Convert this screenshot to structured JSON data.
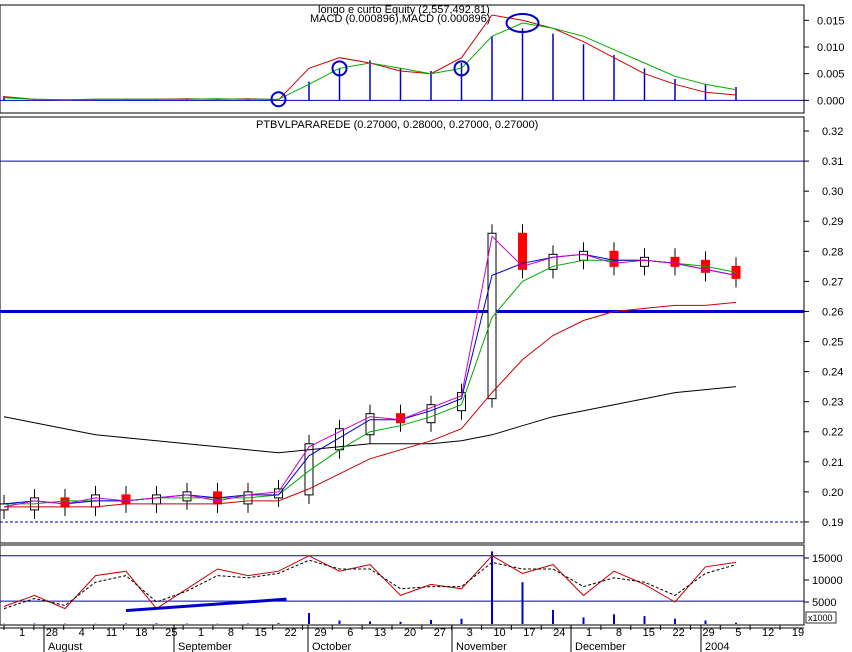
{
  "macd_panel": {
    "title_line1": "longo e curto Equity (2,557,492.81)",
    "title_line2": "MACD (0.000896),MACD (0.000896)",
    "y_ticks": [
      "0.015",
      "0.010",
      "0.005",
      "0.000"
    ],
    "ylim": [
      -0.002,
      0.0175
    ]
  },
  "price_panel": {
    "title": "PTBVLPARAREDE (0.27000, 0.28000, 0.27000, 0.27000)",
    "y_ticks": [
      "0.32",
      "0.31",
      "0.30",
      "0.29",
      "0.28",
      "0.27",
      "0.26",
      "0.25",
      "0.24",
      "0.23",
      "0.22",
      "0.21",
      "0.20",
      "0.19"
    ],
    "ylim": [
      0.184,
      0.324
    ],
    "levels": {
      "resistance": 0.31,
      "support": 0.26,
      "dotted": 0.19
    }
  },
  "volume_panel": {
    "y_ticks": [
      "15000",
      "10000",
      "5000"
    ],
    "unit": "x1000",
    "ylim": [
      0,
      17500
    ],
    "levels": [
      15500,
      5200
    ]
  },
  "x_axis": {
    "day_ticks": [
      "1",
      "28",
      "4",
      "11",
      "18",
      "25",
      "1",
      "8",
      "15",
      "22",
      "29",
      "6",
      "13",
      "20",
      "27",
      "3",
      "10",
      "17",
      "24",
      "1",
      "8",
      "15",
      "22",
      "29",
      "5",
      "12",
      "19"
    ],
    "months": [
      "August",
      "September",
      "October",
      "November",
      "December",
      "2004"
    ]
  },
  "chart_data": {
    "type": "stock-candlestick-with-indicators",
    "instrument": "PTBVLPARAREDE",
    "last": {
      "open": 0.27,
      "high": 0.28,
      "low": 0.27,
      "close": 0.27
    },
    "weeks": [
      "Jul 28",
      "Aug 4",
      "Aug 11",
      "Aug 18",
      "Aug 25",
      "Sep 1",
      "Sep 8",
      "Sep 15",
      "Sep 22",
      "Sep 29",
      "Oct 6",
      "Oct 13",
      "Oct 20",
      "Oct 27",
      "Nov 3",
      "Nov 10",
      "Nov 17",
      "Nov 24",
      "Dec 1",
      "Dec 8",
      "Dec 15",
      "Dec 22",
      "Dec 29",
      "Jan 5",
      "Jan 12"
    ],
    "price_close": [
      0.195,
      0.197,
      0.196,
      0.198,
      0.197,
      0.198,
      0.199,
      0.197,
      0.199,
      0.2,
      0.215,
      0.22,
      0.225,
      0.224,
      0.228,
      0.232,
      0.285,
      0.275,
      0.278,
      0.279,
      0.276,
      0.277,
      0.276,
      0.274,
      0.272
    ],
    "ma_short": [
      0.196,
      0.197,
      0.196,
      0.197,
      0.197,
      0.198,
      0.199,
      0.198,
      0.199,
      0.199,
      0.212,
      0.218,
      0.224,
      0.224,
      0.227,
      0.231,
      0.272,
      0.276,
      0.278,
      0.279,
      0.277,
      0.277,
      0.276,
      0.274,
      0.272
    ],
    "ma_mid": [
      0.196,
      0.196,
      0.197,
      0.197,
      0.197,
      0.198,
      0.198,
      0.198,
      0.198,
      0.199,
      0.207,
      0.214,
      0.22,
      0.222,
      0.225,
      0.229,
      0.258,
      0.27,
      0.275,
      0.277,
      0.277,
      0.277,
      0.276,
      0.275,
      0.273
    ],
    "ma_long": [
      0.195,
      0.195,
      0.195,
      0.195,
      0.196,
      0.196,
      0.196,
      0.196,
      0.197,
      0.197,
      0.201,
      0.206,
      0.211,
      0.214,
      0.217,
      0.221,
      0.233,
      0.244,
      0.252,
      0.257,
      0.26,
      0.261,
      0.262,
      0.262,
      0.263
    ],
    "ma_longest": [
      0.225,
      0.223,
      0.221,
      0.219,
      0.218,
      0.217,
      0.216,
      0.215,
      0.214,
      0.213,
      0.214,
      0.215,
      0.216,
      0.216,
      0.216,
      0.217,
      0.219,
      0.222,
      0.225,
      0.227,
      0.229,
      0.231,
      0.233,
      0.234,
      0.235
    ],
    "macd_line": [
      0.0007,
      0.0002,
      0.0001,
      0.0002,
      0.0002,
      0.0002,
      0.0003,
      0.0002,
      0.0003,
      0.0001,
      0.006,
      0.008,
      0.007,
      0.0055,
      0.005,
      0.008,
      0.016,
      0.015,
      0.0135,
      0.011,
      0.008,
      0.005,
      0.003,
      0.0015,
      0.001
    ],
    "macd_signal": [
      0.0005,
      0.0002,
      0.0001,
      0.0002,
      0.0002,
      0.0002,
      0.0002,
      0.0003,
      0.0002,
      0.0002,
      0.003,
      0.006,
      0.007,
      0.006,
      0.005,
      0.006,
      0.012,
      0.0145,
      0.0135,
      0.012,
      0.0095,
      0.007,
      0.0045,
      0.003,
      0.002
    ],
    "macd_hist": [
      0.0008,
      0.0003,
      0.0002,
      0.0002,
      0.0003,
      0.0003,
      0.0002,
      0.0003,
      0.0002,
      0.0002,
      0.0035,
      0.006,
      0.0075,
      0.006,
      0.0055,
      0.007,
      0.012,
      0.0135,
      0.0125,
      0.0105,
      0.0085,
      0.006,
      0.004,
      0.003,
      0.0025
    ],
    "stoch_k": [
      4000,
      6500,
      3500,
      11000,
      12000,
      3500,
      8000,
      12500,
      11000,
      12000,
      15500,
      12000,
      13500,
      6500,
      9000,
      8000,
      15500,
      11500,
      13500,
      6500,
      12000,
      9000,
      5000,
      13000,
      14000
    ],
    "stoch_d": [
      3500,
      5800,
      4200,
      9500,
      11000,
      5000,
      7500,
      11000,
      10500,
      11500,
      14500,
      12500,
      12500,
      8000,
      8500,
      8500,
      14000,
      12500,
      12500,
      8500,
      10500,
      9500,
      6500,
      11500,
      13500
    ],
    "volume": [
      50,
      100,
      80,
      60,
      120,
      150,
      90,
      70,
      110,
      200,
      2500,
      800,
      600,
      500,
      900,
      1200,
      16500,
      9500,
      3200,
      1500,
      2200,
      1800,
      1200,
      800,
      300
    ],
    "ylim_price": [
      0.184,
      0.324
    ],
    "grid": false
  },
  "colors": {
    "candle_up": "#ff0000",
    "candle_down": "#000000",
    "ma_short": "#cc00cc",
    "ma_mid": "#0000cc",
    "ma_green": "#00aa00",
    "ma_red": "#cc0000",
    "ma_black": "#000000",
    "level": "#0000cc",
    "macd_hist": "#0000cc",
    "stoch": "#cc0000",
    "volume": "#0000cc"
  }
}
